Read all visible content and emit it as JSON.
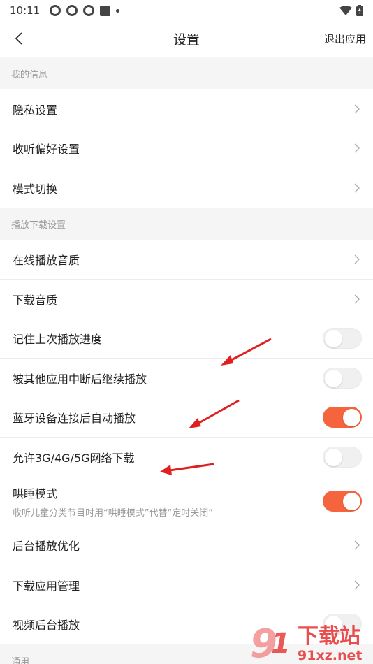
{
  "status": {
    "time": "10:11"
  },
  "header": {
    "title": "设置",
    "exit_label": "退出应用"
  },
  "sections": [
    {
      "title": "我的信息"
    },
    {
      "title": "播放下载设置"
    },
    {
      "title": "通用"
    }
  ],
  "my_info": {
    "privacy": "隐私设置",
    "listen_pref": "收听偏好设置",
    "mode_switch": "模式切换"
  },
  "playback": {
    "online_quality": "在线播放音质",
    "download_quality": "下载音质",
    "remember_progress": "记住上次播放进度",
    "resume_after_interrupt": "被其他应用中断后继续播放",
    "bluetooth_autoplay": "蓝牙设备连接后自动播放",
    "allow_mobile_download": "允许3G/4G/5G网络下载",
    "sleep_mode": "哄睡模式",
    "sleep_mode_desc": "收听儿童分类节目时用“哄睡模式”代替“定时关闭”",
    "bg_optimize": "后台播放优化",
    "download_app_mgmt": "下载应用管理",
    "video_bg_play": "视频后台播放"
  },
  "toggles": {
    "remember_progress": false,
    "resume_after_interrupt": false,
    "bluetooth_autoplay": true,
    "allow_mobile_download": false,
    "sleep_mode": true,
    "video_bg_play": false
  },
  "colors": {
    "accent": "#f5643c",
    "arrow": "#e02020"
  },
  "watermark": {
    "brand": "下载站",
    "domain": "91xz.net"
  }
}
